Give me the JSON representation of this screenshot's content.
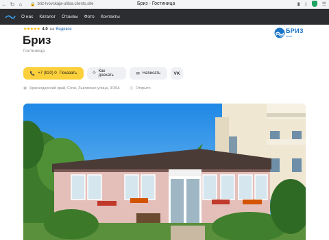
{
  "browser": {
    "url": "briz-lvovskaja-ulitsa.clients.site",
    "tab_title": "Бриз - Гостиница"
  },
  "nav": {
    "items": [
      "О нас",
      "Каталог",
      "Отзывы",
      "Фото",
      "Контакты"
    ]
  },
  "rating": {
    "stars": "★★★★★",
    "value": "4.0",
    "source_prefix": "на",
    "source": "Яндексе",
    "score_fraction": 0.8
  },
  "business": {
    "name": "Бриз",
    "category": "Гостиница",
    "logo_word": "БРИЗ",
    "logo_tagline": "отель"
  },
  "actions": {
    "phone_number": "+7 (920) 0",
    "phone_label": "Показать",
    "route_label": "Как доехать",
    "message_label": "Написать",
    "vk_label": "VK"
  },
  "meta": {
    "address": "Краснодарский край, Сочи, Львовская улица, 3/39А",
    "status": "Открыто"
  },
  "colors": {
    "accent_yellow": "#fcd03b",
    "nav_bg": "#2b2d31",
    "brand_blue": "#1a75c8"
  },
  "icons": {
    "reload": "reload-icon",
    "lock": "lock-icon",
    "location": "location-pin-icon",
    "clock": "clock-icon"
  }
}
